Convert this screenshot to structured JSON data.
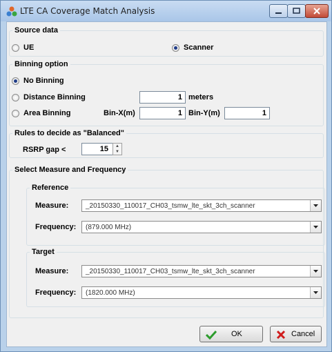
{
  "window": {
    "title": "LTE CA Coverage Match Analysis"
  },
  "source_data": {
    "label": "Source data",
    "ue_label": "UE",
    "scanner_label": "Scanner",
    "selected": "Scanner"
  },
  "binning": {
    "label": "Binning option",
    "no_binning_label": "No Binning",
    "distance_label": "Distance Binning",
    "distance_value": "1",
    "distance_unit": "meters",
    "area_label": "Area Binning",
    "bin_x_label": "Bin-X(m)",
    "bin_x_value": "1",
    "bin_y_label": "Bin-Y(m)",
    "bin_y_value": "1",
    "selected": "No Binning"
  },
  "rules": {
    "label": "Rules to decide as \"Balanced\"",
    "rsrp_label": "RSRP gap <",
    "rsrp_value": "15"
  },
  "measure_freq": {
    "label": "Select Measure and Frequency",
    "reference": {
      "label": "Reference",
      "measure_label": "Measure:",
      "measure_value": "_20150330_110017_CH03_tsmw_lte_skt_3ch_scanner",
      "frequency_label": "Frequency:",
      "frequency_value": "(879.000 MHz)"
    },
    "target": {
      "label": "Target",
      "measure_label": "Measure:",
      "measure_value": "_20150330_110017_CH03_tsmw_lte_skt_3ch_scanner",
      "frequency_label": "Frequency:",
      "frequency_value": "(1820.000 MHz)"
    }
  },
  "buttons": {
    "ok_label": "OK",
    "cancel_label": "Cancel"
  },
  "colors": {
    "accent": "#1f3c88",
    "ok_check": "#2c9c2c",
    "cancel_x": "#d01c1c",
    "titlebar": "#b9d1ea"
  }
}
